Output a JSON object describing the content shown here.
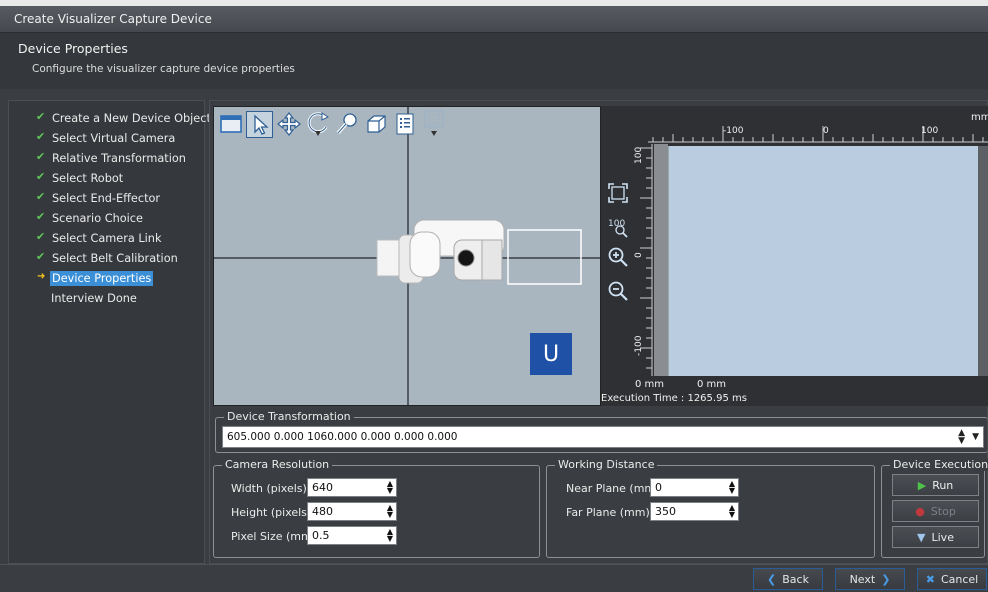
{
  "window": {
    "title": "Create Visualizer Capture Device"
  },
  "header": {
    "title": "Device Properties",
    "subtitle": "Configure the visualizer capture device properties"
  },
  "steps": [
    {
      "label": "Create a New Device Object",
      "state": "done"
    },
    {
      "label": "Select Virtual Camera",
      "state": "done"
    },
    {
      "label": "Relative Transformation",
      "state": "done"
    },
    {
      "label": "Select Robot",
      "state": "done"
    },
    {
      "label": "Select End-Effector",
      "state": "done"
    },
    {
      "label": "Scenario Choice",
      "state": "done"
    },
    {
      "label": "Select Camera Link",
      "state": "done"
    },
    {
      "label": "Select Belt Calibration",
      "state": "done"
    },
    {
      "label": "Device Properties",
      "state": "current"
    },
    {
      "label": "Interview Done",
      "state": "pending"
    }
  ],
  "viewport": {
    "toolbar_icons": [
      "window-icon",
      "select-arrow-icon",
      "pan-icon",
      "rotate-icon",
      "zoom-icon",
      "cube-icon",
      "properties-icon",
      "view-options-icon"
    ],
    "overlay_badge": "U"
  },
  "camera_view": {
    "ruler_unit": "mm",
    "h_ticks": [
      "-100",
      "0",
      "100"
    ],
    "v_ticks": [
      "100",
      "0",
      "-100"
    ],
    "tools": [
      "fit-icon",
      "zoom-100-icon",
      "zoom-in-icon",
      "zoom-out-icon"
    ],
    "coord_x": "0 mm",
    "coord_y": "0 mm",
    "execution_time": "Execution Time : 1265.95 ms"
  },
  "transformation": {
    "legend": "Device Transformation",
    "value": "605.000 0.000 1060.000 0.000 0.000 0.000"
  },
  "camera_resolution": {
    "legend": "Camera Resolution",
    "width_label": "Width (pixels)",
    "width_value": "640",
    "height_label": "Height (pixels)",
    "height_value": "480",
    "pixel_label": "Pixel Size (mm)",
    "pixel_value": "0.5"
  },
  "working_distance": {
    "legend": "Working Distance",
    "near_label": "Near Plane (mm)",
    "near_value": "0",
    "far_label": "Far Plane (mm)",
    "far_value": "350"
  },
  "device_execution": {
    "legend": "Device Execution",
    "run_label": "Run",
    "stop_label": "Stop",
    "live_label": "Live"
  },
  "footer": {
    "back_label": "Back",
    "next_label": "Next",
    "cancel_label": "Cancel"
  }
}
